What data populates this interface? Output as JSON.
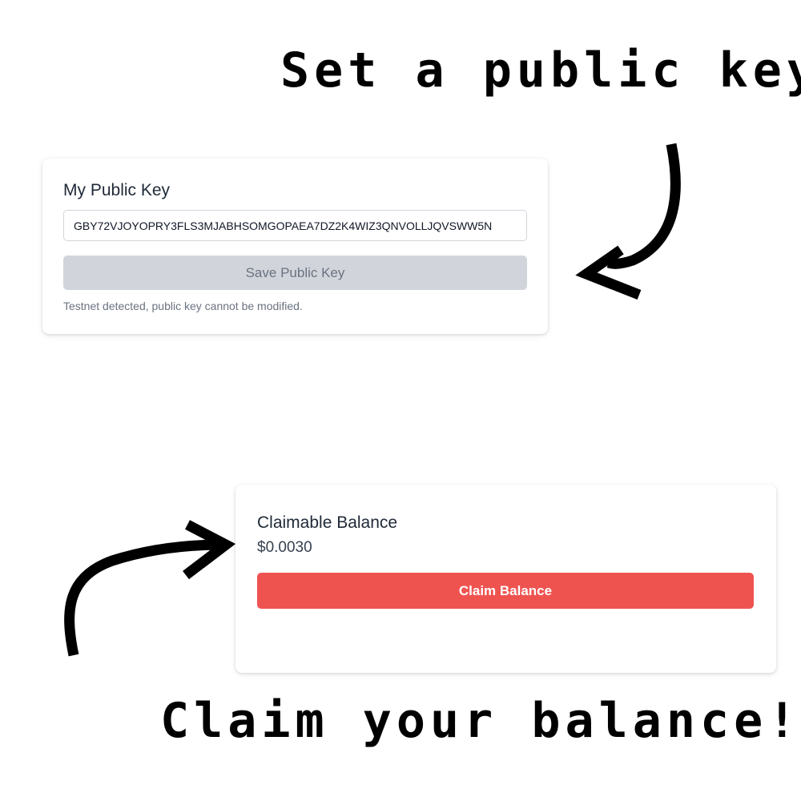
{
  "annotations": {
    "top_caption": "Set a public key",
    "bottom_caption": "Claim your balance!"
  },
  "public_key_card": {
    "title": "My Public Key",
    "input_value": "GBY72VJOYOPRY3FLS3MJABHSOMGOPAEA7DZ2K4WIZ3QNVOLLJQVSWW5N",
    "save_label": "Save Public Key",
    "note": "Testnet detected, public key cannot be modified."
  },
  "balance_card": {
    "title": "Claimable Balance",
    "amount": "$0.0030",
    "claim_label": "Claim Balance"
  },
  "colors": {
    "claim_button": "#ef5350",
    "disabled_button": "#d1d5db",
    "arrow": "#000000"
  },
  "icons": [
    "hand-drawn-arrow-down-left",
    "hand-drawn-arrow-up-right"
  ]
}
